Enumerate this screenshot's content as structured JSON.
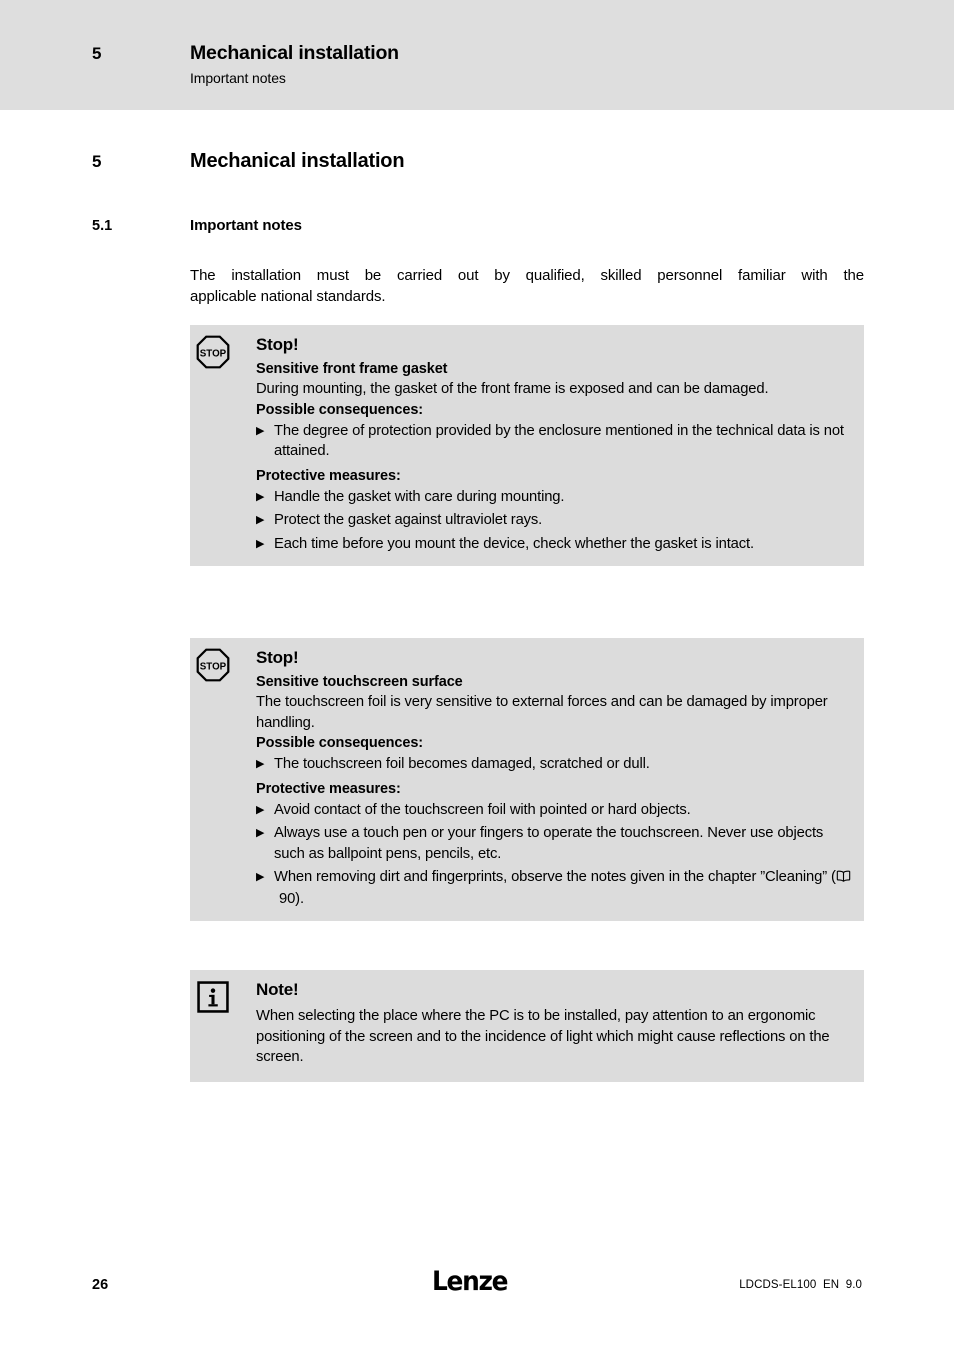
{
  "header": {
    "number": "5",
    "title": "Mechanical installation",
    "subtitle": "Important notes"
  },
  "chapter": {
    "number": "5",
    "title": "Mechanical installation"
  },
  "section": {
    "number": "5.1",
    "title": "Important notes"
  },
  "intro": {
    "line1": "The installation must be carried out by qualified, skilled personnel familiar with the",
    "line2": "applicable national standards."
  },
  "boxes": [
    {
      "icon": "stop-sign-icon",
      "icon_label": "STOP",
      "heading": "Stop!",
      "subheading": "Sensitive front frame gasket",
      "text": "During mounting, the gasket of the front frame is exposed and can be damaged.",
      "consequences_label": "Possible consequences:",
      "consequences": [
        "The degree of protection provided by the enclosure mentioned in the technical data is not attained."
      ],
      "measures_label": "Protective measures:",
      "measures": [
        "Handle the gasket with care during mounting.",
        "Protect the gasket against ultraviolet rays.",
        "Each time before you mount the device, check whether the gasket is intact."
      ]
    },
    {
      "icon": "stop-sign-icon",
      "icon_label": "STOP",
      "heading": "Stop!",
      "subheading": "Sensitive touchscreen surface",
      "text": "The touchscreen foil is very sensitive to external forces and can be damaged by improper handling.",
      "consequences_label": "Possible consequences:",
      "consequences": [
        "The touchscreen foil becomes damaged, scratched or dull."
      ],
      "measures_label": "Protective measures:",
      "measures": [
        "Avoid contact of the touchscreen foil with pointed or hard objects.",
        "Always use a touch pen or your fingers to operate the touchscreen. Never use objects such as ballpoint pens, pencils, etc."
      ],
      "measure_with_ref": {
        "prefix": "When removing dirt and fingerprints, observe the notes given in the chapter ”Cleaning” (",
        "page_ref": "90",
        "suffix": ")."
      }
    },
    {
      "icon": "info-icon",
      "icon_label": "i",
      "heading": "Note!",
      "text": "When selecting the place where the PC is to be installed, pay attention to an ergonomic positioning of the screen and to the incidence of light which might cause reflections on the screen."
    }
  ],
  "footer": {
    "page_number": "26",
    "logo": "Lenze",
    "document_code": "LDCDS-EL100  EN  9.0"
  },
  "colors": {
    "header_band": "#dedede",
    "box_background": "#dcdcdc",
    "text": "#000000",
    "page_background": "#ffffff"
  }
}
